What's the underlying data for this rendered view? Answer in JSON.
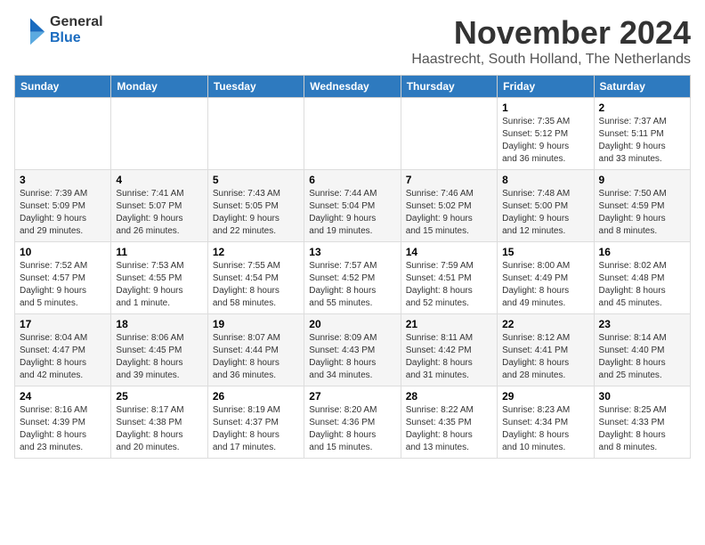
{
  "logo": {
    "general": "General",
    "blue": "Blue"
  },
  "header": {
    "month": "November 2024",
    "location": "Haastrecht, South Holland, The Netherlands"
  },
  "weekdays": [
    "Sunday",
    "Monday",
    "Tuesday",
    "Wednesday",
    "Thursday",
    "Friday",
    "Saturday"
  ],
  "weeks": [
    [
      {
        "day": "",
        "info": ""
      },
      {
        "day": "",
        "info": ""
      },
      {
        "day": "",
        "info": ""
      },
      {
        "day": "",
        "info": ""
      },
      {
        "day": "",
        "info": ""
      },
      {
        "day": "1",
        "info": "Sunrise: 7:35 AM\nSunset: 5:12 PM\nDaylight: 9 hours\nand 36 minutes."
      },
      {
        "day": "2",
        "info": "Sunrise: 7:37 AM\nSunset: 5:11 PM\nDaylight: 9 hours\nand 33 minutes."
      }
    ],
    [
      {
        "day": "3",
        "info": "Sunrise: 7:39 AM\nSunset: 5:09 PM\nDaylight: 9 hours\nand 29 minutes."
      },
      {
        "day": "4",
        "info": "Sunrise: 7:41 AM\nSunset: 5:07 PM\nDaylight: 9 hours\nand 26 minutes."
      },
      {
        "day": "5",
        "info": "Sunrise: 7:43 AM\nSunset: 5:05 PM\nDaylight: 9 hours\nand 22 minutes."
      },
      {
        "day": "6",
        "info": "Sunrise: 7:44 AM\nSunset: 5:04 PM\nDaylight: 9 hours\nand 19 minutes."
      },
      {
        "day": "7",
        "info": "Sunrise: 7:46 AM\nSunset: 5:02 PM\nDaylight: 9 hours\nand 15 minutes."
      },
      {
        "day": "8",
        "info": "Sunrise: 7:48 AM\nSunset: 5:00 PM\nDaylight: 9 hours\nand 12 minutes."
      },
      {
        "day": "9",
        "info": "Sunrise: 7:50 AM\nSunset: 4:59 PM\nDaylight: 9 hours\nand 8 minutes."
      }
    ],
    [
      {
        "day": "10",
        "info": "Sunrise: 7:52 AM\nSunset: 4:57 PM\nDaylight: 9 hours\nand 5 minutes."
      },
      {
        "day": "11",
        "info": "Sunrise: 7:53 AM\nSunset: 4:55 PM\nDaylight: 9 hours\nand 1 minute."
      },
      {
        "day": "12",
        "info": "Sunrise: 7:55 AM\nSunset: 4:54 PM\nDaylight: 8 hours\nand 58 minutes."
      },
      {
        "day": "13",
        "info": "Sunrise: 7:57 AM\nSunset: 4:52 PM\nDaylight: 8 hours\nand 55 minutes."
      },
      {
        "day": "14",
        "info": "Sunrise: 7:59 AM\nSunset: 4:51 PM\nDaylight: 8 hours\nand 52 minutes."
      },
      {
        "day": "15",
        "info": "Sunrise: 8:00 AM\nSunset: 4:49 PM\nDaylight: 8 hours\nand 49 minutes."
      },
      {
        "day": "16",
        "info": "Sunrise: 8:02 AM\nSunset: 4:48 PM\nDaylight: 8 hours\nand 45 minutes."
      }
    ],
    [
      {
        "day": "17",
        "info": "Sunrise: 8:04 AM\nSunset: 4:47 PM\nDaylight: 8 hours\nand 42 minutes."
      },
      {
        "day": "18",
        "info": "Sunrise: 8:06 AM\nSunset: 4:45 PM\nDaylight: 8 hours\nand 39 minutes."
      },
      {
        "day": "19",
        "info": "Sunrise: 8:07 AM\nSunset: 4:44 PM\nDaylight: 8 hours\nand 36 minutes."
      },
      {
        "day": "20",
        "info": "Sunrise: 8:09 AM\nSunset: 4:43 PM\nDaylight: 8 hours\nand 34 minutes."
      },
      {
        "day": "21",
        "info": "Sunrise: 8:11 AM\nSunset: 4:42 PM\nDaylight: 8 hours\nand 31 minutes."
      },
      {
        "day": "22",
        "info": "Sunrise: 8:12 AM\nSunset: 4:41 PM\nDaylight: 8 hours\nand 28 minutes."
      },
      {
        "day": "23",
        "info": "Sunrise: 8:14 AM\nSunset: 4:40 PM\nDaylight: 8 hours\nand 25 minutes."
      }
    ],
    [
      {
        "day": "24",
        "info": "Sunrise: 8:16 AM\nSunset: 4:39 PM\nDaylight: 8 hours\nand 23 minutes."
      },
      {
        "day": "25",
        "info": "Sunrise: 8:17 AM\nSunset: 4:38 PM\nDaylight: 8 hours\nand 20 minutes."
      },
      {
        "day": "26",
        "info": "Sunrise: 8:19 AM\nSunset: 4:37 PM\nDaylight: 8 hours\nand 17 minutes."
      },
      {
        "day": "27",
        "info": "Sunrise: 8:20 AM\nSunset: 4:36 PM\nDaylight: 8 hours\nand 15 minutes."
      },
      {
        "day": "28",
        "info": "Sunrise: 8:22 AM\nSunset: 4:35 PM\nDaylight: 8 hours\nand 13 minutes."
      },
      {
        "day": "29",
        "info": "Sunrise: 8:23 AM\nSunset: 4:34 PM\nDaylight: 8 hours\nand 10 minutes."
      },
      {
        "day": "30",
        "info": "Sunrise: 8:25 AM\nSunset: 4:33 PM\nDaylight: 8 hours\nand 8 minutes."
      }
    ]
  ]
}
